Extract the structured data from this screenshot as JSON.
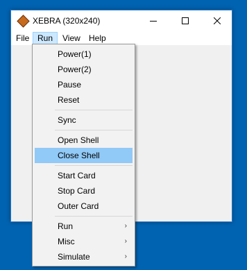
{
  "window": {
    "title": "XEBRA (320x240)"
  },
  "menubar": {
    "items": [
      "File",
      "Run",
      "View",
      "Help"
    ]
  },
  "run_menu": {
    "items": [
      {
        "label": "Power(1)"
      },
      {
        "label": "Power(2)"
      },
      {
        "label": "Pause"
      },
      {
        "label": "Reset"
      },
      {
        "label": "Sync"
      },
      {
        "label": "Open Shell"
      },
      {
        "label": "Close Shell",
        "highlighted": true
      },
      {
        "label": "Start Card"
      },
      {
        "label": "Stop Card"
      },
      {
        "label": "Outer Card"
      },
      {
        "label": "Run",
        "submenu": true
      },
      {
        "label": "Misc",
        "submenu": true
      },
      {
        "label": "Simulate",
        "submenu": true
      }
    ],
    "submenu_arrow": "›"
  },
  "colors": {
    "desktop": "#0063b1",
    "highlight": "#91c9f7",
    "menu_active": "#cce8ff"
  }
}
